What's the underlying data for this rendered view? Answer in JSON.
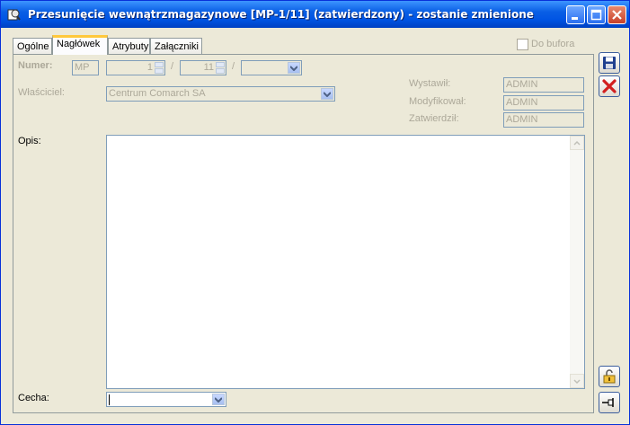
{
  "window": {
    "title": "Przesunięcie wewnątrzmagazynowe [MP-1/11] (zatwierdzony) - zostanie zmienione"
  },
  "tabs": [
    {
      "label": "Ogólne",
      "active": false
    },
    {
      "label": "Nagłówek",
      "active": true
    },
    {
      "label": "Atrybuty",
      "active": false
    },
    {
      "label": "Załączniki",
      "active": false
    }
  ],
  "do_bufora": {
    "label": "Do bufora",
    "checked": false
  },
  "numer": {
    "label": "Numer:",
    "prefix": "MP",
    "number": "1",
    "month": "11",
    "separator": "/",
    "series": ""
  },
  "wlasciciel": {
    "label": "Właściciel:",
    "value": "Centrum Comarch SA"
  },
  "audit": {
    "wystawil_label": "Wystawił:",
    "wystawil_value": "ADMIN",
    "modyfikowal_label": "Modyfikował:",
    "modyfikowal_value": "ADMIN",
    "zatwierdzil_label": "Zatwierdził:",
    "zatwierdzil_value": "ADMIN"
  },
  "opis": {
    "label": "Opis:",
    "value": ""
  },
  "cecha": {
    "label": "Cecha:",
    "value": ""
  },
  "icons": {
    "save": "floppy-disk-icon",
    "cancel": "red-x-icon",
    "lock": "open-padlock-icon",
    "pin": "pushpin-icon"
  },
  "colors": {
    "titlebar": "#0054e3",
    "tab_highlight": "#ffc83c",
    "cancel_red": "#d21f1f"
  }
}
